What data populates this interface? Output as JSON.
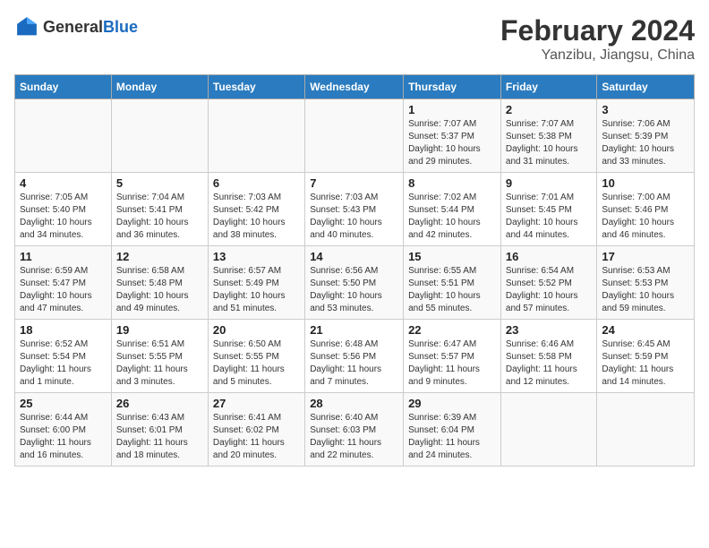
{
  "logo": {
    "general": "General",
    "blue": "Blue"
  },
  "header": {
    "title": "February 2024",
    "subtitle": "Yanzibu, Jiangsu, China"
  },
  "days_of_week": [
    "Sunday",
    "Monday",
    "Tuesday",
    "Wednesday",
    "Thursday",
    "Friday",
    "Saturday"
  ],
  "weeks": [
    [
      {
        "day": "",
        "detail": ""
      },
      {
        "day": "",
        "detail": ""
      },
      {
        "day": "",
        "detail": ""
      },
      {
        "day": "",
        "detail": ""
      },
      {
        "day": "1",
        "detail": "Sunrise: 7:07 AM\nSunset: 5:37 PM\nDaylight: 10 hours\nand 29 minutes."
      },
      {
        "day": "2",
        "detail": "Sunrise: 7:07 AM\nSunset: 5:38 PM\nDaylight: 10 hours\nand 31 minutes."
      },
      {
        "day": "3",
        "detail": "Sunrise: 7:06 AM\nSunset: 5:39 PM\nDaylight: 10 hours\nand 33 minutes."
      }
    ],
    [
      {
        "day": "4",
        "detail": "Sunrise: 7:05 AM\nSunset: 5:40 PM\nDaylight: 10 hours\nand 34 minutes."
      },
      {
        "day": "5",
        "detail": "Sunrise: 7:04 AM\nSunset: 5:41 PM\nDaylight: 10 hours\nand 36 minutes."
      },
      {
        "day": "6",
        "detail": "Sunrise: 7:03 AM\nSunset: 5:42 PM\nDaylight: 10 hours\nand 38 minutes."
      },
      {
        "day": "7",
        "detail": "Sunrise: 7:03 AM\nSunset: 5:43 PM\nDaylight: 10 hours\nand 40 minutes."
      },
      {
        "day": "8",
        "detail": "Sunrise: 7:02 AM\nSunset: 5:44 PM\nDaylight: 10 hours\nand 42 minutes."
      },
      {
        "day": "9",
        "detail": "Sunrise: 7:01 AM\nSunset: 5:45 PM\nDaylight: 10 hours\nand 44 minutes."
      },
      {
        "day": "10",
        "detail": "Sunrise: 7:00 AM\nSunset: 5:46 PM\nDaylight: 10 hours\nand 46 minutes."
      }
    ],
    [
      {
        "day": "11",
        "detail": "Sunrise: 6:59 AM\nSunset: 5:47 PM\nDaylight: 10 hours\nand 47 minutes."
      },
      {
        "day": "12",
        "detail": "Sunrise: 6:58 AM\nSunset: 5:48 PM\nDaylight: 10 hours\nand 49 minutes."
      },
      {
        "day": "13",
        "detail": "Sunrise: 6:57 AM\nSunset: 5:49 PM\nDaylight: 10 hours\nand 51 minutes."
      },
      {
        "day": "14",
        "detail": "Sunrise: 6:56 AM\nSunset: 5:50 PM\nDaylight: 10 hours\nand 53 minutes."
      },
      {
        "day": "15",
        "detail": "Sunrise: 6:55 AM\nSunset: 5:51 PM\nDaylight: 10 hours\nand 55 minutes."
      },
      {
        "day": "16",
        "detail": "Sunrise: 6:54 AM\nSunset: 5:52 PM\nDaylight: 10 hours\nand 57 minutes."
      },
      {
        "day": "17",
        "detail": "Sunrise: 6:53 AM\nSunset: 5:53 PM\nDaylight: 10 hours\nand 59 minutes."
      }
    ],
    [
      {
        "day": "18",
        "detail": "Sunrise: 6:52 AM\nSunset: 5:54 PM\nDaylight: 11 hours\nand 1 minute."
      },
      {
        "day": "19",
        "detail": "Sunrise: 6:51 AM\nSunset: 5:55 PM\nDaylight: 11 hours\nand 3 minutes."
      },
      {
        "day": "20",
        "detail": "Sunrise: 6:50 AM\nSunset: 5:55 PM\nDaylight: 11 hours\nand 5 minutes."
      },
      {
        "day": "21",
        "detail": "Sunrise: 6:48 AM\nSunset: 5:56 PM\nDaylight: 11 hours\nand 7 minutes."
      },
      {
        "day": "22",
        "detail": "Sunrise: 6:47 AM\nSunset: 5:57 PM\nDaylight: 11 hours\nand 9 minutes."
      },
      {
        "day": "23",
        "detail": "Sunrise: 6:46 AM\nSunset: 5:58 PM\nDaylight: 11 hours\nand 12 minutes."
      },
      {
        "day": "24",
        "detail": "Sunrise: 6:45 AM\nSunset: 5:59 PM\nDaylight: 11 hours\nand 14 minutes."
      }
    ],
    [
      {
        "day": "25",
        "detail": "Sunrise: 6:44 AM\nSunset: 6:00 PM\nDaylight: 11 hours\nand 16 minutes."
      },
      {
        "day": "26",
        "detail": "Sunrise: 6:43 AM\nSunset: 6:01 PM\nDaylight: 11 hours\nand 18 minutes."
      },
      {
        "day": "27",
        "detail": "Sunrise: 6:41 AM\nSunset: 6:02 PM\nDaylight: 11 hours\nand 20 minutes."
      },
      {
        "day": "28",
        "detail": "Sunrise: 6:40 AM\nSunset: 6:03 PM\nDaylight: 11 hours\nand 22 minutes."
      },
      {
        "day": "29",
        "detail": "Sunrise: 6:39 AM\nSunset: 6:04 PM\nDaylight: 11 hours\nand 24 minutes."
      },
      {
        "day": "",
        "detail": ""
      },
      {
        "day": "",
        "detail": ""
      }
    ]
  ]
}
